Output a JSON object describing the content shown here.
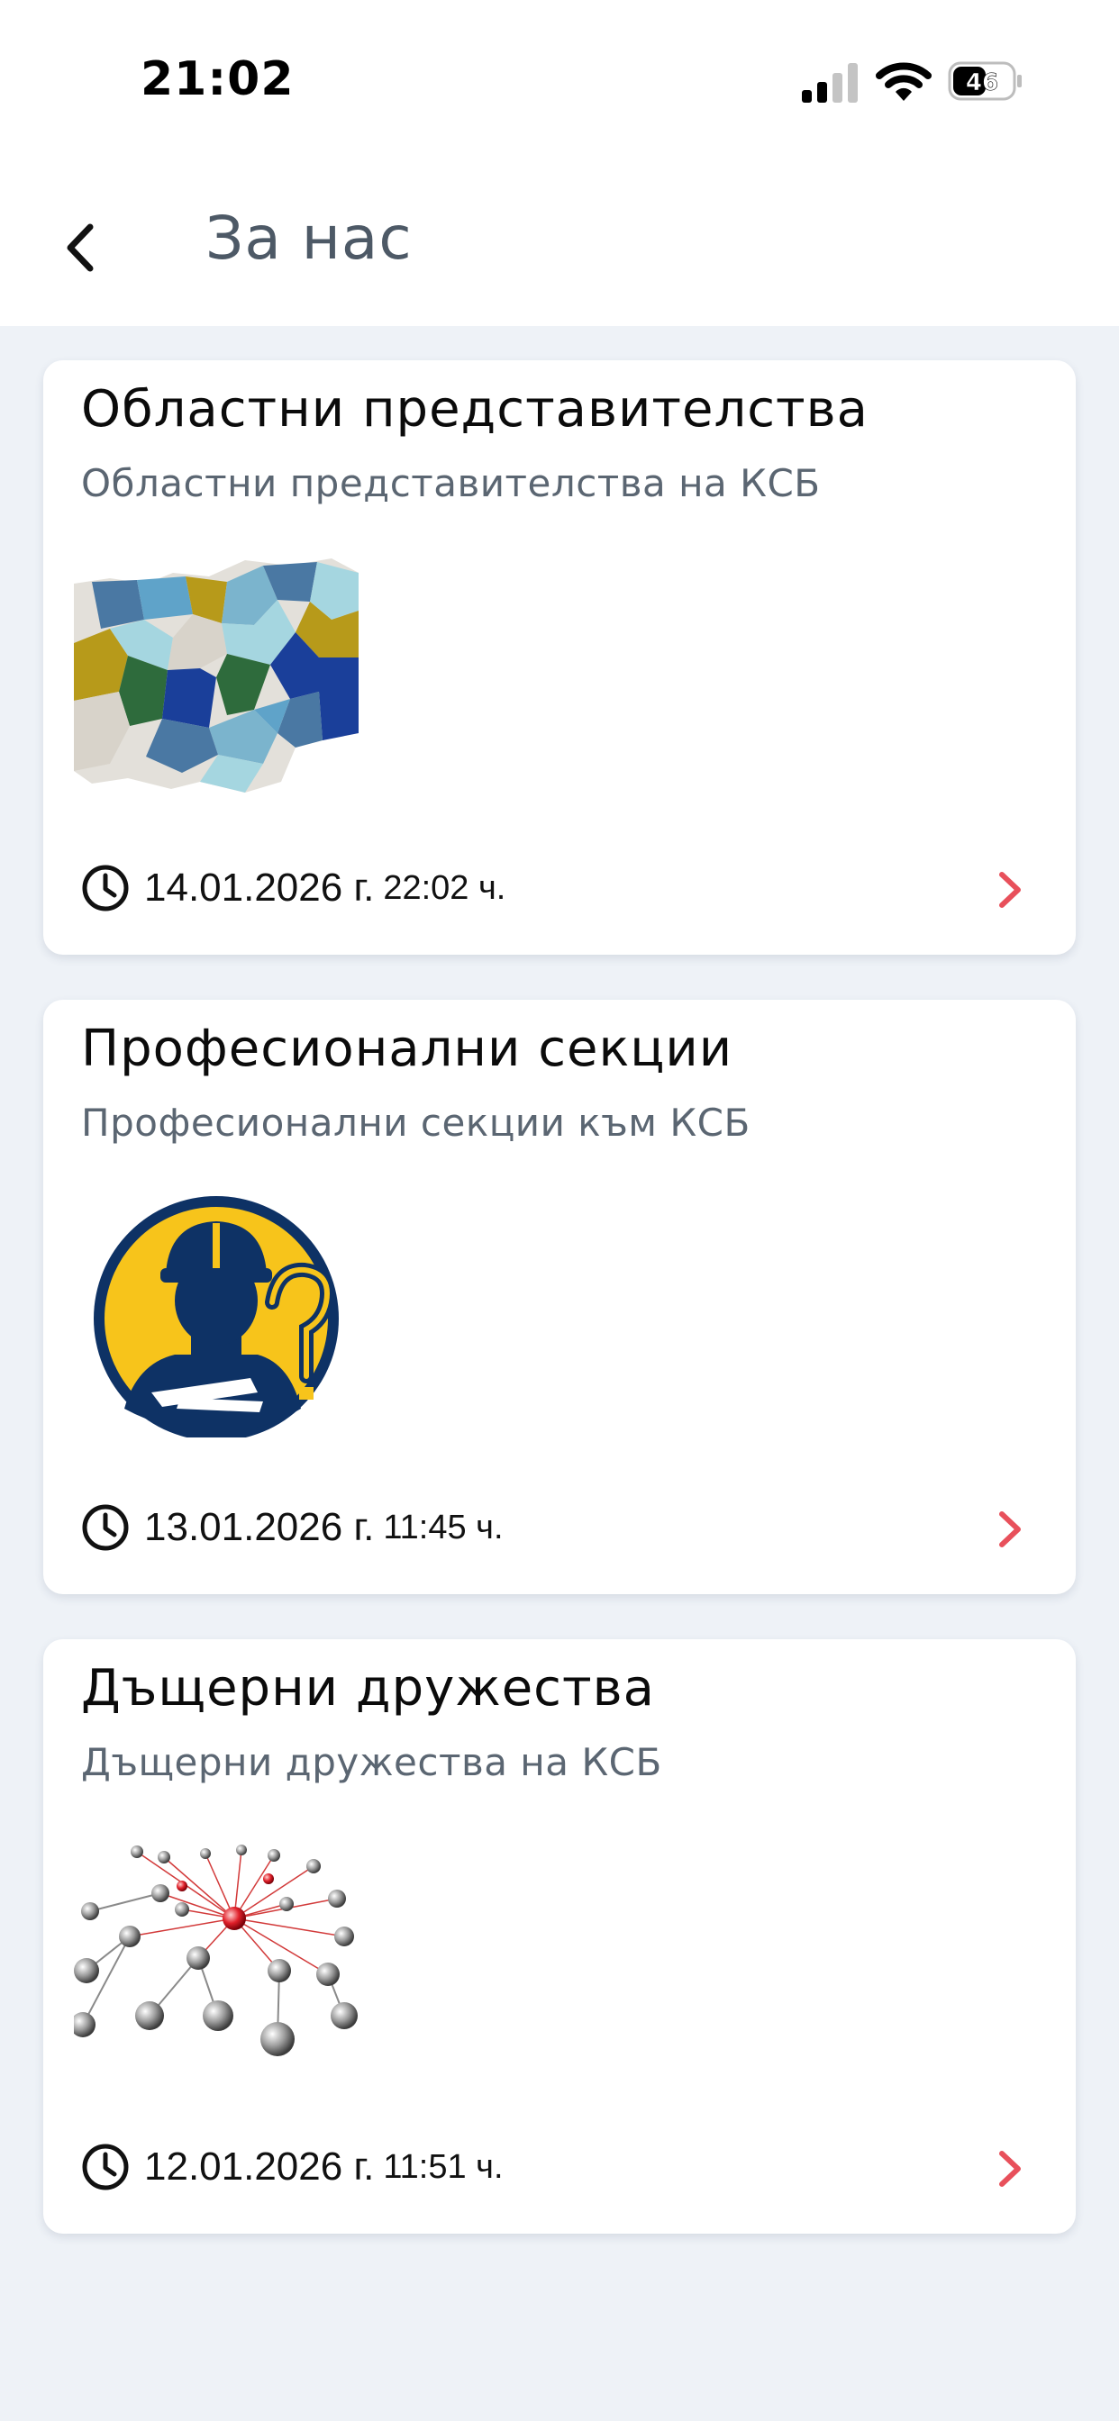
{
  "status_bar": {
    "time": "21:02",
    "battery": "46"
  },
  "header": {
    "title": "За нас",
    "back_icon": "chevron-left-icon"
  },
  "cards": [
    {
      "title": "Областни представителства",
      "subtitle": "Областни представителства на КСБ",
      "image": "bulgaria-regions-map",
      "date": "14.01.2026 г.",
      "time": "22:02 ч."
    },
    {
      "title": "Професионални секции",
      "subtitle": "Професионални секции към КСБ",
      "image": "builder-question-logo",
      "date": "13.01.2026 г.",
      "time": "11:45 ч."
    },
    {
      "title": "Дъщерни дружества",
      "subtitle": "Дъщерни дружества на КСБ",
      "image": "network-spheres-image",
      "date": "12.01.2026 г.",
      "time": "11:51 ч."
    }
  ],
  "colors": {
    "background": "#eef2f7",
    "card": "#ffffff",
    "accent_chevron": "#e8505b",
    "title_gray": "#4d5966",
    "subtitle_gray": "#5b6672"
  }
}
